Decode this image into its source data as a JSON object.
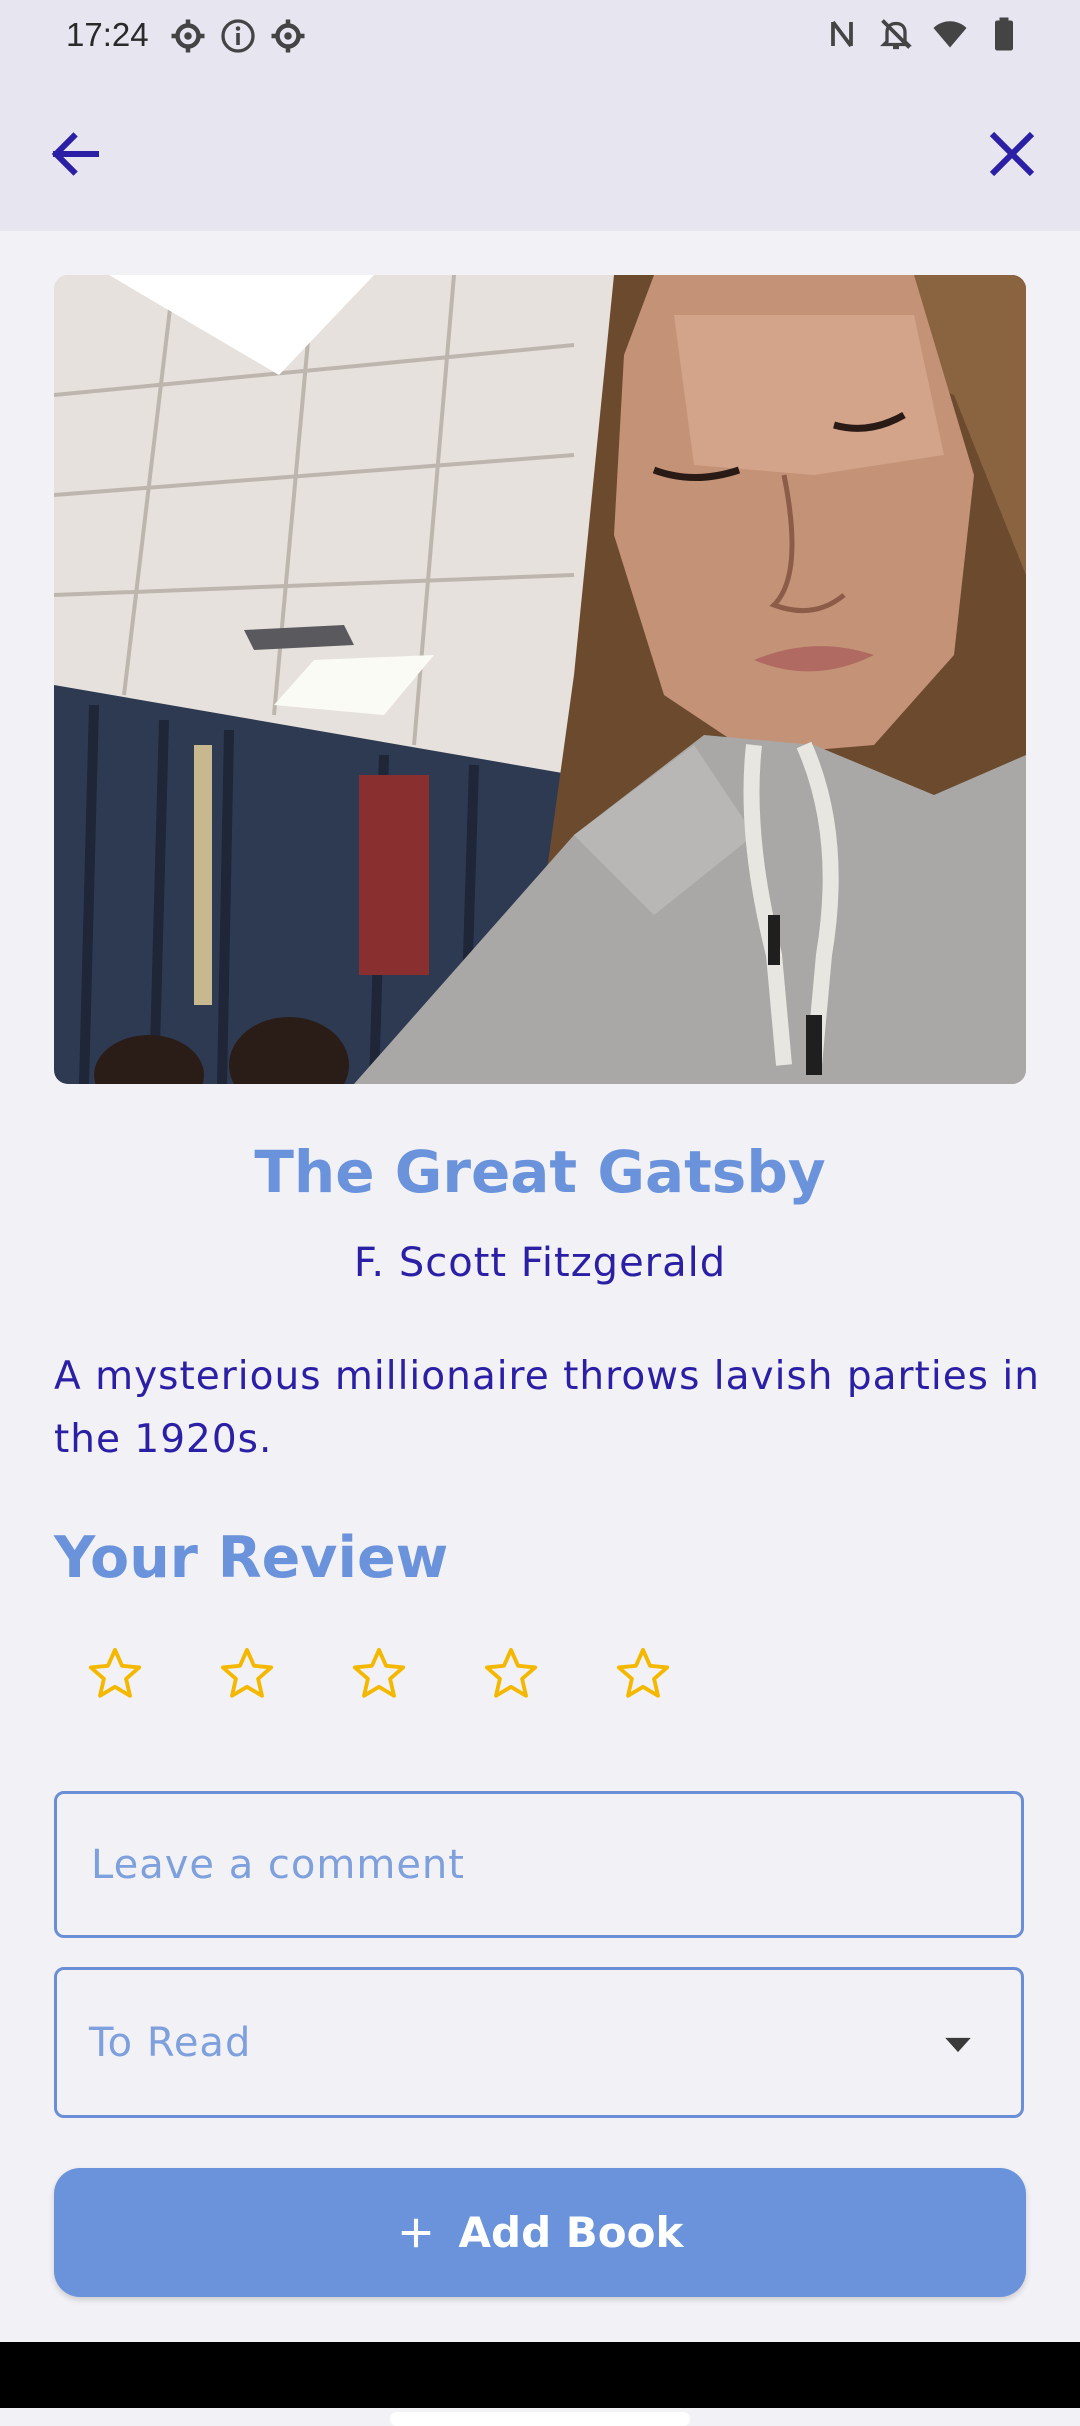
{
  "status_bar": {
    "time": "17:24",
    "left_icons": [
      "gear-icon",
      "info-icon",
      "gear-icon"
    ],
    "right_icons": [
      "nfc-icon",
      "bell-off-icon",
      "wifi-icon",
      "battery-icon"
    ]
  },
  "app_bar": {
    "back_icon": "arrow-left-icon",
    "close_icon": "close-icon",
    "icon_color": "#2b1fa5"
  },
  "book": {
    "cover_image": "photo",
    "title": "The Great Gatsby",
    "author": "F. Scott Fitzgerald",
    "description": "A mysterious millionaire throws lavish parties in the 1920s."
  },
  "review": {
    "heading": "Your Review",
    "rating": 0,
    "max_rating": 5,
    "star_color": "#f5b800",
    "comment_placeholder": "Leave a comment",
    "comment_value": ""
  },
  "reading_status": {
    "selected": "To Read"
  },
  "actions": {
    "add_label": "Add Book"
  },
  "colors": {
    "accent": "#6a93db",
    "text_dark": "#2b1fa5",
    "background": "#f2f1f6",
    "app_bar": "#e6e5f0"
  }
}
